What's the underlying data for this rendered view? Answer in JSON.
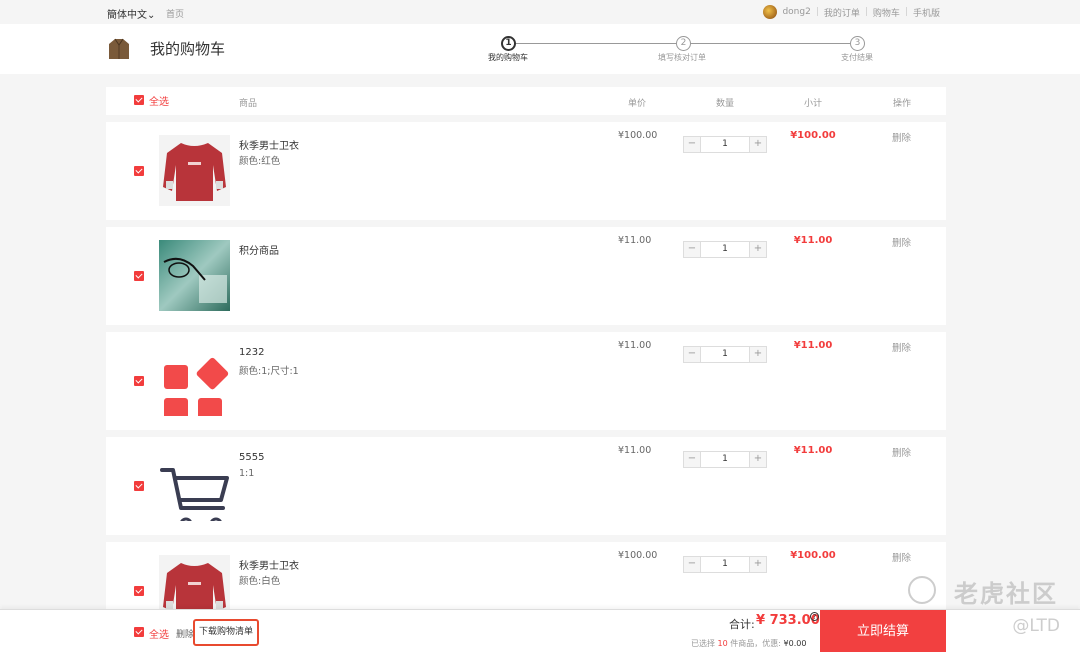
{
  "topbar": {
    "language": "簡体中文",
    "home": "首页",
    "username": "dong2",
    "links": [
      "我的订单",
      "购物车",
      "手机版"
    ]
  },
  "header": {
    "title": "我的购物车",
    "steps": [
      {
        "num": "1",
        "label": "我的购物车"
      },
      {
        "num": "2",
        "label": "填写核对订单"
      },
      {
        "num": "3",
        "label": "支付结果"
      }
    ]
  },
  "table_head": {
    "select_all": "全选",
    "product": "商品",
    "unit_price": "单价",
    "quantity": "数量",
    "subtotal": "小计",
    "action": "操作"
  },
  "items": [
    {
      "name": "秋季男士卫衣",
      "spec": "颜色:红色",
      "price": "¥100.00",
      "qty": "1",
      "subtotal": "¥100.00",
      "action": "删除",
      "image": "red-sweatshirt"
    },
    {
      "name": "积分商品",
      "spec": "",
      "price": "¥11.00",
      "qty": "1",
      "subtotal": "¥11.00",
      "action": "删除",
      "image": "glasses-photo"
    },
    {
      "name": "1232",
      "spec": "颜色:1;尺寸:1",
      "price": "¥11.00",
      "qty": "1",
      "subtotal": "¥11.00",
      "action": "删除",
      "image": "red-apps-icon"
    },
    {
      "name": "5555",
      "spec": "1:1",
      "price": "¥11.00",
      "qty": "1",
      "subtotal": "¥11.00",
      "action": "删除",
      "image": "shopping-cart-icon"
    },
    {
      "name": "秋季男士卫衣",
      "spec": "颜色:白色",
      "price": "¥100.00",
      "qty": "1",
      "subtotal": "¥100.00",
      "action": "删除",
      "image": "red-sweatshirt"
    }
  ],
  "stepper": {
    "minus": "−",
    "plus": "+"
  },
  "footer": {
    "select_all": "全选",
    "delete": "删除",
    "download": "下载购物清单",
    "total_label": "合计:",
    "total_value": "¥ 733.00",
    "help": "?",
    "selected_prefix": "已选择",
    "selected_count": "10",
    "selected_suffix": "件商品，优惠:",
    "discount": "¥0.00",
    "checkout": "立即结算"
  },
  "watermark": {
    "text": "老虎社区",
    "sub": "@LTD"
  },
  "colors": {
    "accent": "#f23c3c",
    "checkout": "#f24040",
    "highlight_border": "#e84a2f"
  }
}
